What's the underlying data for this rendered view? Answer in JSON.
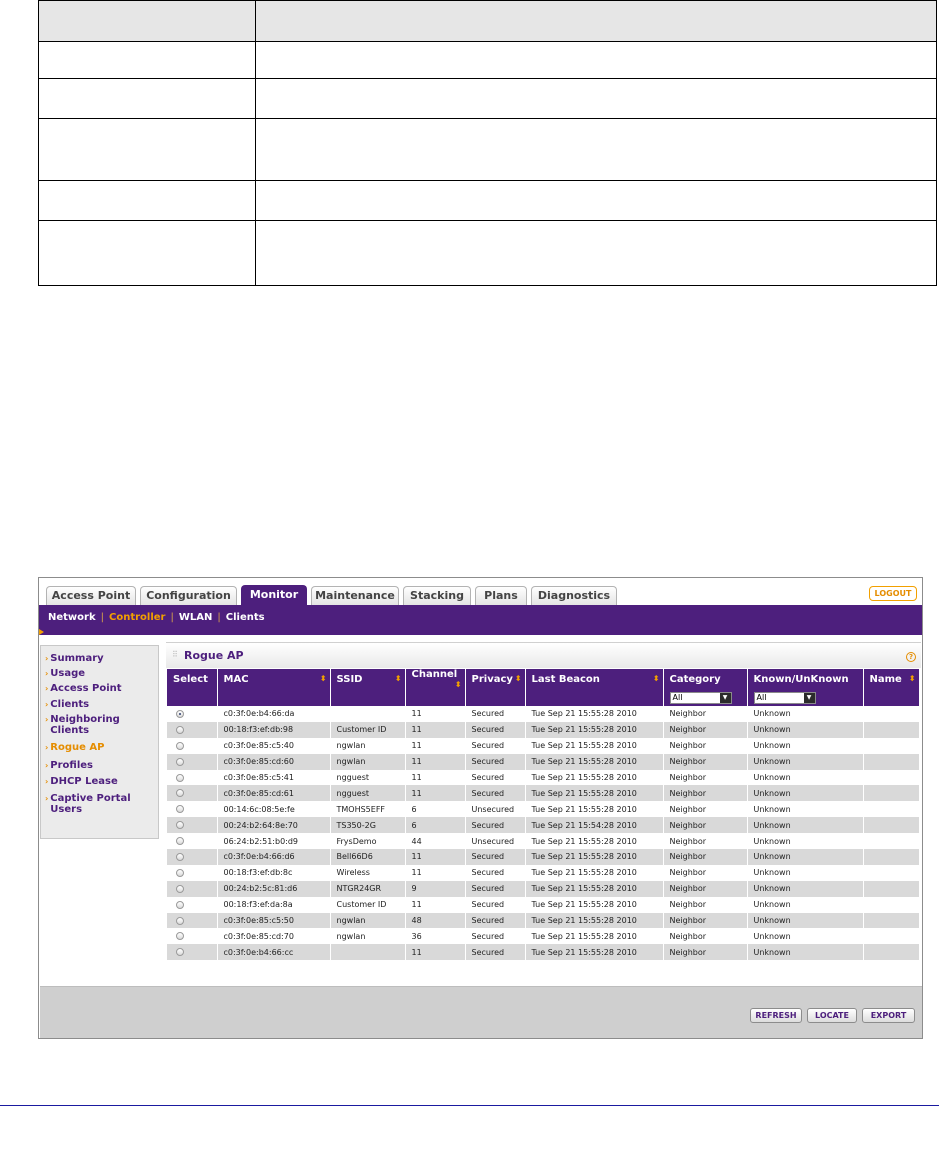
{
  "tabs": [
    {
      "label": "Access Point"
    },
    {
      "label": "Configuration"
    },
    {
      "label": "Monitor",
      "active": true
    },
    {
      "label": "Maintenance"
    },
    {
      "label": "Stacking"
    },
    {
      "label": "Plans"
    },
    {
      "label": "Diagnostics"
    }
  ],
  "logout_label": "LOGOUT",
  "subnav": {
    "items": [
      "Network",
      "Controller",
      "WLAN",
      "Clients"
    ],
    "separator": "|",
    "active": "Controller"
  },
  "sidebar": {
    "items": [
      {
        "label": "Summary"
      },
      {
        "label": "Usage"
      },
      {
        "label": "Access Point"
      },
      {
        "label": "Clients"
      },
      {
        "label": "Neighboring Clients"
      },
      {
        "label": "Rogue AP",
        "active": true
      },
      {
        "label": "Profiles"
      },
      {
        "label": "DHCP Lease"
      },
      {
        "label": "Captive Portal Users"
      }
    ]
  },
  "panel": {
    "title": "Rogue AP",
    "help_icon": "?",
    "columns": [
      "Select",
      "MAC",
      "SSID",
      "Channel",
      "Privacy",
      "Last Beacon",
      "Category",
      "Known/UnKnown",
      "Name"
    ],
    "category_filter": "All",
    "known_filter": "All",
    "rows": [
      {
        "selected": true,
        "mac": "c0:3f:0e:b4:66:da",
        "ssid": "",
        "channel": "11",
        "privacy": "Secured",
        "last_beacon": "Tue Sep 21 15:55:28 2010",
        "category": "Neighbor",
        "known": "Unknown",
        "name": ""
      },
      {
        "selected": false,
        "mac": "00:18:f3:ef:db:98",
        "ssid": "Customer ID",
        "channel": "11",
        "privacy": "Secured",
        "last_beacon": "Tue Sep 21 15:55:28 2010",
        "category": "Neighbor",
        "known": "Unknown",
        "name": ""
      },
      {
        "selected": false,
        "mac": "c0:3f:0e:85:c5:40",
        "ssid": "ngwlan",
        "channel": "11",
        "privacy": "Secured",
        "last_beacon": "Tue Sep 21 15:55:28 2010",
        "category": "Neighbor",
        "known": "Unknown",
        "name": ""
      },
      {
        "selected": false,
        "mac": "c0:3f:0e:85:cd:60",
        "ssid": "ngwlan",
        "channel": "11",
        "privacy": "Secured",
        "last_beacon": "Tue Sep 21 15:55:28 2010",
        "category": "Neighbor",
        "known": "Unknown",
        "name": ""
      },
      {
        "selected": false,
        "mac": "c0:3f:0e:85:c5:41",
        "ssid": "ngguest",
        "channel": "11",
        "privacy": "Secured",
        "last_beacon": "Tue Sep 21 15:55:28 2010",
        "category": "Neighbor",
        "known": "Unknown",
        "name": ""
      },
      {
        "selected": false,
        "mac": "c0:3f:0e:85:cd:61",
        "ssid": "ngguest",
        "channel": "11",
        "privacy": "Secured",
        "last_beacon": "Tue Sep 21 15:55:28 2010",
        "category": "Neighbor",
        "known": "Unknown",
        "name": ""
      },
      {
        "selected": false,
        "mac": "00:14:6c:08:5e:fe",
        "ssid": "TMOHS5EFF",
        "channel": "6",
        "privacy": "Unsecured",
        "last_beacon": "Tue Sep 21 15:55:28 2010",
        "category": "Neighbor",
        "known": "Unknown",
        "name": ""
      },
      {
        "selected": false,
        "mac": "00:24:b2:64:8e:70",
        "ssid": "TS350-2G",
        "channel": "6",
        "privacy": "Secured",
        "last_beacon": "Tue Sep 21 15:54:28 2010",
        "category": "Neighbor",
        "known": "Unknown",
        "name": ""
      },
      {
        "selected": false,
        "mac": "06:24:b2:51:b0:d9",
        "ssid": "FrysDemo",
        "channel": "44",
        "privacy": "Unsecured",
        "last_beacon": "Tue Sep 21 15:55:28 2010",
        "category": "Neighbor",
        "known": "Unknown",
        "name": ""
      },
      {
        "selected": false,
        "mac": "c0:3f:0e:b4:66:d6",
        "ssid": "Bell66D6",
        "channel": "11",
        "privacy": "Secured",
        "last_beacon": "Tue Sep 21 15:55:28 2010",
        "category": "Neighbor",
        "known": "Unknown",
        "name": ""
      },
      {
        "selected": false,
        "mac": "00:18:f3:ef:db:8c",
        "ssid": "Wireless",
        "channel": "11",
        "privacy": "Secured",
        "last_beacon": "Tue Sep 21 15:55:28 2010",
        "category": "Neighbor",
        "known": "Unknown",
        "name": ""
      },
      {
        "selected": false,
        "mac": "00:24:b2:5c:81:d6",
        "ssid": "NTGR24GR",
        "channel": "9",
        "privacy": "Secured",
        "last_beacon": "Tue Sep 21 15:55:28 2010",
        "category": "Neighbor",
        "known": "Unknown",
        "name": ""
      },
      {
        "selected": false,
        "mac": "00:18:f3:ef:da:8a",
        "ssid": "Customer ID",
        "channel": "11",
        "privacy": "Secured",
        "last_beacon": "Tue Sep 21 15:55:28 2010",
        "category": "Neighbor",
        "known": "Unknown",
        "name": ""
      },
      {
        "selected": false,
        "mac": "c0:3f:0e:85:c5:50",
        "ssid": "ngwlan",
        "channel": "48",
        "privacy": "Secured",
        "last_beacon": "Tue Sep 21 15:55:28 2010",
        "category": "Neighbor",
        "known": "Unknown",
        "name": ""
      },
      {
        "selected": false,
        "mac": "c0:3f:0e:85:cd:70",
        "ssid": "ngwlan",
        "channel": "36",
        "privacy": "Secured",
        "last_beacon": "Tue Sep 21 15:55:28 2010",
        "category": "Neighbor",
        "known": "Unknown",
        "name": ""
      },
      {
        "selected": false,
        "mac": "c0:3f:0e:b4:66:cc",
        "ssid": "",
        "channel": "11",
        "privacy": "Secured",
        "last_beacon": "Tue Sep 21 15:55:28 2010",
        "category": "Neighbor",
        "known": "Unknown",
        "name": ""
      }
    ]
  },
  "buttons": {
    "refresh": "REFRESH",
    "locate": "LOCATE",
    "export": "EXPORT"
  },
  "colors": {
    "brand_purple": "#4d1f7d",
    "accent_orange": "#f2a000",
    "link_blue": "#1a1aa0"
  }
}
